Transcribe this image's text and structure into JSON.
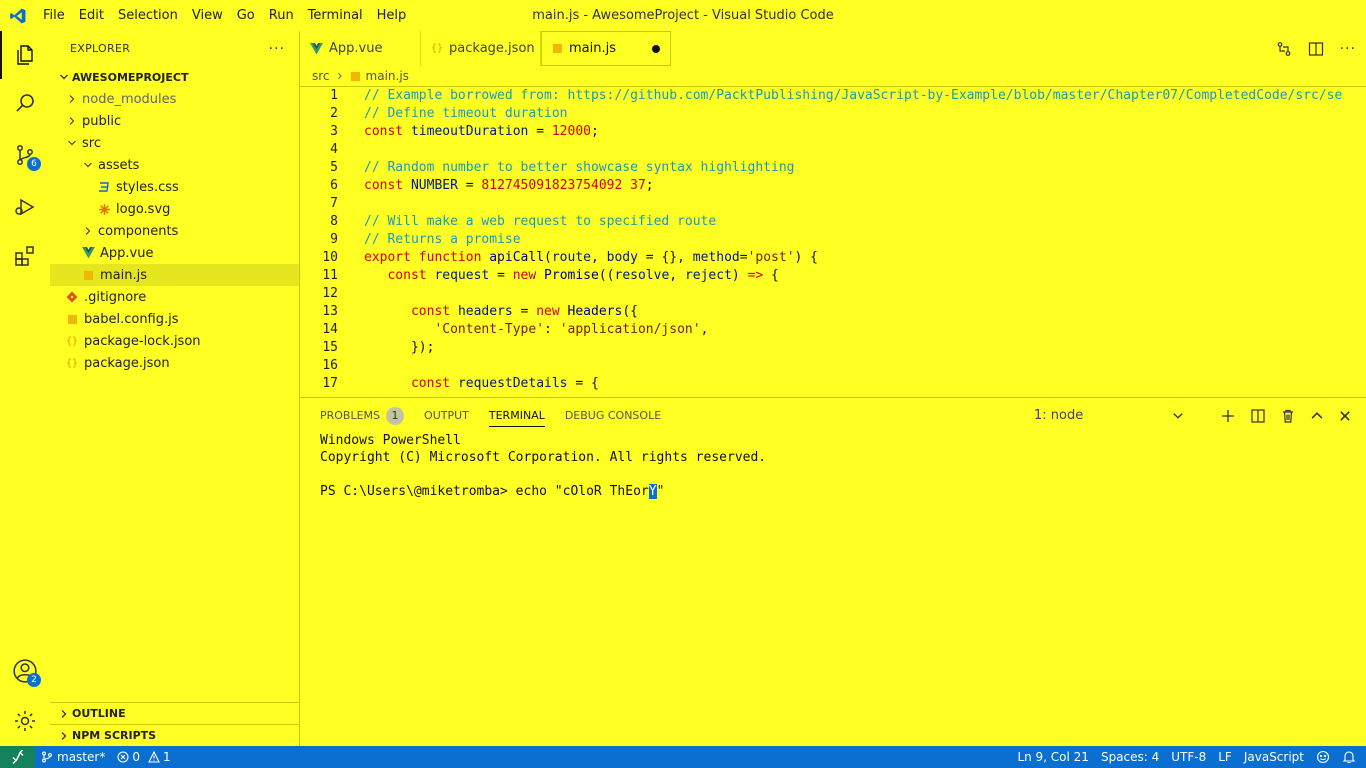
{
  "window": {
    "title": "main.js - AwesomeProject - Visual Studio Code"
  },
  "menu": [
    "File",
    "Edit",
    "Selection",
    "View",
    "Go",
    "Run",
    "Terminal",
    "Help"
  ],
  "activity": {
    "scm_badge": "6",
    "accounts_badge": "2"
  },
  "sidebar": {
    "title": "EXPLORER",
    "root": "AWESOMEPROJECT",
    "tree": [
      {
        "label": "node_modules",
        "depth": 0,
        "kind": "folder",
        "expanded": false,
        "dim": true
      },
      {
        "label": "public",
        "depth": 0,
        "kind": "folder",
        "expanded": false
      },
      {
        "label": "src",
        "depth": 0,
        "kind": "folder",
        "expanded": true
      },
      {
        "label": "assets",
        "depth": 1,
        "kind": "folder",
        "expanded": true
      },
      {
        "label": "styles.css",
        "depth": 2,
        "kind": "css"
      },
      {
        "label": "logo.svg",
        "depth": 2,
        "kind": "svg"
      },
      {
        "label": "components",
        "depth": 1,
        "kind": "folder",
        "expanded": false
      },
      {
        "label": "App.vue",
        "depth": 1,
        "kind": "vue"
      },
      {
        "label": "main.js",
        "depth": 1,
        "kind": "js",
        "selected": true
      },
      {
        "label": ".gitignore",
        "depth": 0,
        "kind": "git"
      },
      {
        "label": "babel.config.js",
        "depth": 0,
        "kind": "js"
      },
      {
        "label": "package-lock.json",
        "depth": 0,
        "kind": "json"
      },
      {
        "label": "package.json",
        "depth": 0,
        "kind": "json"
      }
    ],
    "outline": "OUTLINE",
    "npm_scripts": "NPM SCRIPTS"
  },
  "tabs": [
    {
      "label": "App.vue",
      "kind": "vue"
    },
    {
      "label": "package.json",
      "kind": "json"
    },
    {
      "label": "main.js",
      "kind": "js",
      "active": true,
      "dirty": true
    }
  ],
  "breadcrumb": {
    "folder": "src",
    "file": "main.js"
  },
  "code": [
    [
      [
        "cm",
        "// Example borrowed from: https://github.com/PacktPublishing/JavaScript-by-Example/blob/master/Chapter07/CompletedCode/src/se"
      ]
    ],
    [
      [
        "cm",
        "// Define timeout duration"
      ]
    ],
    [
      [
        "kw",
        "const "
      ],
      [
        "id",
        "timeoutDuration"
      ],
      [
        "plain",
        " = "
      ],
      [
        "num",
        "12000"
      ],
      [
        "plain",
        ";"
      ]
    ],
    [],
    [
      [
        "cm",
        "// Random number to better showcase syntax highlighting"
      ]
    ],
    [
      [
        "kw",
        "const "
      ],
      [
        "id",
        "NUMBER"
      ],
      [
        "plain",
        " = "
      ],
      [
        "num",
        "812745091823754092 37"
      ],
      [
        "plain",
        ";"
      ]
    ],
    [],
    [
      [
        "cm",
        "// Will make a web request to specified route"
      ]
    ],
    [
      [
        "cm",
        "// Returns a promise"
      ]
    ],
    [
      [
        "kw",
        "export function "
      ],
      [
        "fn",
        "apiCall"
      ],
      [
        "plain",
        "("
      ],
      [
        "id",
        "route"
      ],
      [
        "plain",
        ", "
      ],
      [
        "id",
        "body"
      ],
      [
        "plain",
        " = {}, "
      ],
      [
        "id",
        "method"
      ],
      [
        "plain",
        "="
      ],
      [
        "str",
        "'post'"
      ],
      [
        "plain",
        ") {"
      ]
    ],
    [
      [
        "plain",
        "   "
      ],
      [
        "kw",
        "const "
      ],
      [
        "id",
        "request"
      ],
      [
        "plain",
        " = "
      ],
      [
        "kw",
        "new "
      ],
      [
        "fn",
        "Promise"
      ],
      [
        "plain",
        "(("
      ],
      [
        "id",
        "resolve"
      ],
      [
        "plain",
        ", "
      ],
      [
        "id",
        "reject"
      ],
      [
        "plain",
        ") "
      ],
      [
        "kw",
        "=>"
      ],
      [
        "plain",
        " {"
      ]
    ],
    [
      [
        "plain",
        "   "
      ]
    ],
    [
      [
        "plain",
        "      "
      ],
      [
        "kw",
        "const "
      ],
      [
        "id",
        "headers"
      ],
      [
        "plain",
        " = "
      ],
      [
        "kw",
        "new "
      ],
      [
        "fn",
        "Headers"
      ],
      [
        "plain",
        "({"
      ]
    ],
    [
      [
        "plain",
        "         "
      ],
      [
        "str",
        "'Content-Type'"
      ],
      [
        "plain",
        ": "
      ],
      [
        "str",
        "'application/json'"
      ],
      [
        "plain",
        ","
      ]
    ],
    [
      [
        "plain",
        "      });"
      ]
    ],
    [],
    [
      [
        "plain",
        "      "
      ],
      [
        "kw",
        "const "
      ],
      [
        "id",
        "requestDetails"
      ],
      [
        "plain",
        " = {"
      ]
    ]
  ],
  "panel": {
    "tabs": [
      "PROBLEMS",
      "OUTPUT",
      "TERMINAL",
      "DEBUG CONSOLE"
    ],
    "problems_count": "1",
    "terminal_select": "1: node",
    "terminal_lines": [
      "Windows PowerShell",
      "Copyright (C) Microsoft Corporation. All rights reserved.",
      "",
      "PS C:\\Users\\@miketromba> echo \"cOloR ThEor"
    ],
    "cursor_char": "Y",
    "after_cursor": "\""
  },
  "status": {
    "branch": "master*",
    "errors": "0",
    "warnings": "1",
    "position": "Ln 9, Col 21",
    "spaces": "Spaces: 4",
    "encoding": "UTF-8",
    "eol": "LF",
    "language": "JavaScript"
  },
  "colors": {
    "background": "#ffff23",
    "statusbar": "#0a6fd0",
    "comment": "#1a9bb5",
    "keyword": "#d40000"
  }
}
